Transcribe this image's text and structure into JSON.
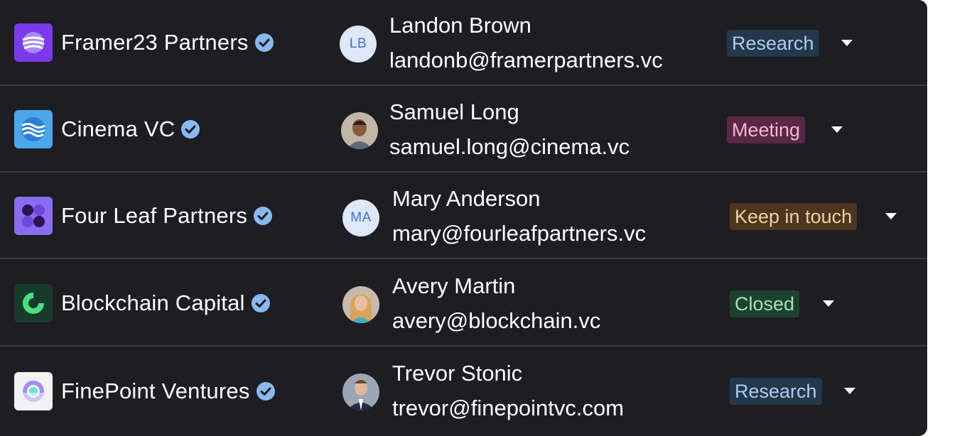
{
  "rows": [
    {
      "company": "Framer23 Partners",
      "logo_icon": "framer23-logo-icon",
      "avatar_initials": "LB",
      "contact_name": "Landon Brown",
      "contact_email": "landonb@framerpartners.vc",
      "status": "Research"
    },
    {
      "company": "Cinema VC",
      "logo_icon": "cinema-vc-logo-icon",
      "avatar_initials": "",
      "contact_name": "Samuel Long",
      "contact_email": "samuel.long@cinema.vc",
      "status": "Meeting"
    },
    {
      "company": "Four Leaf Partners",
      "logo_icon": "four-leaf-logo-icon",
      "avatar_initials": "MA",
      "contact_name": "Mary Anderson",
      "contact_email": "mary@fourleafpartners.vc",
      "status": "Keep in touch"
    },
    {
      "company": "Blockchain Capital",
      "logo_icon": "blockchain-capital-logo-icon",
      "avatar_initials": "",
      "contact_name": "Avery Martin",
      "contact_email": "avery@blockchain.vc",
      "status": "Closed"
    },
    {
      "company": "FinePoint Ventures",
      "logo_icon": "finepoint-logo-icon",
      "avatar_initials": "",
      "contact_name": "Trevor Stonic",
      "contact_email": "trevor@finepointvc.com",
      "status": "Research"
    }
  ],
  "colors": {
    "panel_bg": "#1d1d22",
    "divider": "#3b3b42",
    "verified_badge": "#8ab8f0",
    "research_bg": "#25374a",
    "meeting_bg": "#5a2844",
    "keep_in_touch_bg": "#4c3620",
    "closed_bg": "#1d4131"
  }
}
